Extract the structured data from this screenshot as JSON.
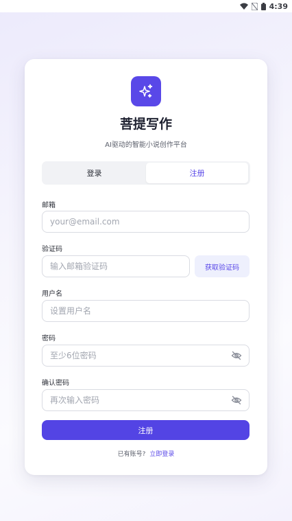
{
  "status_bar": {
    "time": "4:39"
  },
  "brand": {
    "title": "菩提写作",
    "subtitle": "AI驱动的智能小说创作平台",
    "accent_color": "#5948e8",
    "logo_icon": "sparkles-icon"
  },
  "tabs": [
    {
      "label": "登录",
      "active": false
    },
    {
      "label": "注册",
      "active": true
    }
  ],
  "form": {
    "email": {
      "label": "邮箱",
      "value": "",
      "placeholder": "your@email.com"
    },
    "code": {
      "label": "验证码",
      "value": "",
      "placeholder": "输入邮箱验证码",
      "button_label": "获取验证码"
    },
    "username": {
      "label": "用户名",
      "value": "",
      "placeholder": "设置用户名"
    },
    "password": {
      "label": "密码",
      "value": "",
      "placeholder": "至少6位密码",
      "toggle_icon": "eye-off-icon"
    },
    "confirm_password": {
      "label": "确认密码",
      "value": "",
      "placeholder": "再次输入密码",
      "toggle_icon": "eye-off-icon"
    },
    "submit_label": "注册"
  },
  "footer": {
    "prompt": "已有账号?",
    "link_label": "立即登录"
  }
}
